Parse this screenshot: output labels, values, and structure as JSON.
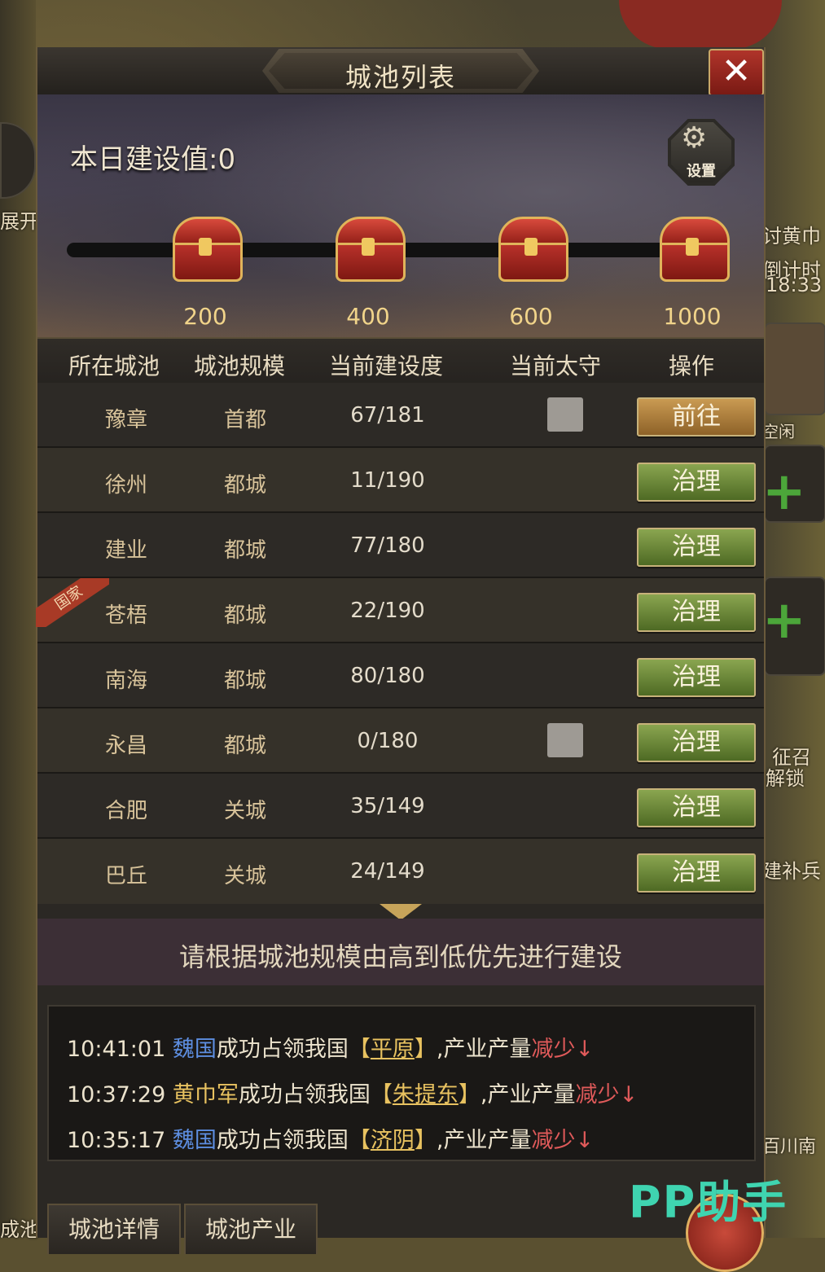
{
  "dialog": {
    "title": "城池列表",
    "close_label": "✕"
  },
  "banner": {
    "construction_label": "本日建设值:0",
    "settings_label": "设置",
    "milestones": [
      "200",
      "400",
      "600",
      "1000"
    ],
    "progress": 0
  },
  "table": {
    "headers": [
      "所在城池",
      "城池规模",
      "当前建设度",
      "当前太守",
      "操作"
    ],
    "rows": [
      {
        "city": "豫章",
        "scale": "首都",
        "progress": "67/181",
        "action": "前往"
      },
      {
        "city": "徐州",
        "scale": "都城",
        "progress": "11/190",
        "action": "治理"
      },
      {
        "city": "建业",
        "scale": "都城",
        "progress": "77/180",
        "action": "治理"
      },
      {
        "city": "苍梧",
        "scale": "都城",
        "progress": "22/190",
        "action": "治理",
        "ribbon": "国家"
      },
      {
        "city": "南海",
        "scale": "都城",
        "progress": "80/180",
        "action": "治理"
      },
      {
        "city": "永昌",
        "scale": "都城",
        "progress": "0/180",
        "action": "治理"
      },
      {
        "city": "合肥",
        "scale": "关城",
        "progress": "35/149",
        "action": "治理"
      },
      {
        "city": "巴丘",
        "scale": "关城",
        "progress": "24/149",
        "action": "治理"
      }
    ]
  },
  "hint": "请根据城池规模由高到低优先进行建设",
  "log": [
    {
      "time": "10:41:01",
      "actor": "魏国",
      "text1": "成功占领我国",
      "bl": "【",
      "place": "平原",
      "br": "】",
      "text2": ",产业产量",
      "effect": "减少↓"
    },
    {
      "time": "10:37:29",
      "actor": "黄巾军",
      "text1": "成功占领我国",
      "bl": "【",
      "place": "朱提东",
      "br": "】",
      "text2": ",产业产量",
      "effect": "减少↓"
    },
    {
      "time": "10:35:17",
      "actor": "魏国",
      "text1": "成功占领我国",
      "bl": "【",
      "place": "济阴",
      "br": "】",
      "text2": ",产业产量",
      "effect": "减少↓"
    }
  ],
  "tabs": [
    "城池详情",
    "城池产业"
  ],
  "side": {
    "left_expand": "展开",
    "left_city": "成池",
    "right_yellow": "讨黄巾",
    "right_countdown_label": "倒计时",
    "right_countdown": "18:33",
    "right_idle": "空闲",
    "right_unlock1": "征召",
    "right_unlock2": "解锁",
    "right_supply": "建补兵",
    "right_place": "百川南"
  },
  "watermark": "PP助手",
  "colors": {
    "button_go": "#c99a52",
    "button_manage": "#6e8a3a",
    "enemy_blue": "#5d8ee0",
    "place_yellow": "#e8c260",
    "decrease_red": "#e05a5a"
  }
}
